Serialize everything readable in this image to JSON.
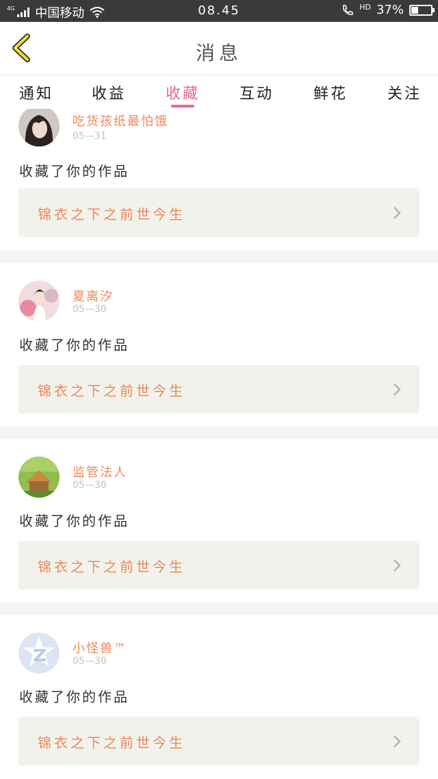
{
  "status_bar": {
    "network_type": "4G",
    "carrier": "中国移动",
    "time": "08.45",
    "hd": "HD",
    "battery_percent": "37%",
    "battery_level": 0.37
  },
  "header": {
    "title": "消息",
    "back_icon": "chevron-left-icon"
  },
  "tabs": [
    {
      "label": "通知",
      "active": false
    },
    {
      "label": "收益",
      "active": false
    },
    {
      "label": "收藏",
      "active": true
    },
    {
      "label": "互动",
      "active": false
    },
    {
      "label": "鲜花",
      "active": false
    },
    {
      "label": "关注",
      "active": false
    }
  ],
  "colors": {
    "accent_pink": "#e4679a",
    "accent_orange": "#f0875a",
    "status_bar": "#3a3a3a",
    "work_box": "#f2f2ec"
  },
  "messages": [
    {
      "user": "吃货孩纸最怕饿",
      "date": "05—31",
      "action": "收藏了你的作品",
      "work_title": "锦衣之下之前世今生",
      "avatar": "user-avatar-photo"
    },
    {
      "user": "夏离汐",
      "date": "05—30",
      "action": "收藏了你的作品",
      "work_title": "锦衣之下之前世今生",
      "avatar": "user-avatar-painting"
    },
    {
      "user": "监管法人",
      "date": "05—30",
      "action": "收藏了你的作品",
      "work_title": "锦衣之下之前世今生",
      "avatar": "user-avatar-landscape"
    },
    {
      "user": "小怪兽™",
      "date": "05—30",
      "action": "收藏了你的作品",
      "work_title": "锦衣之下之前世今生",
      "avatar": "qq-default-avatar-icon"
    }
  ]
}
